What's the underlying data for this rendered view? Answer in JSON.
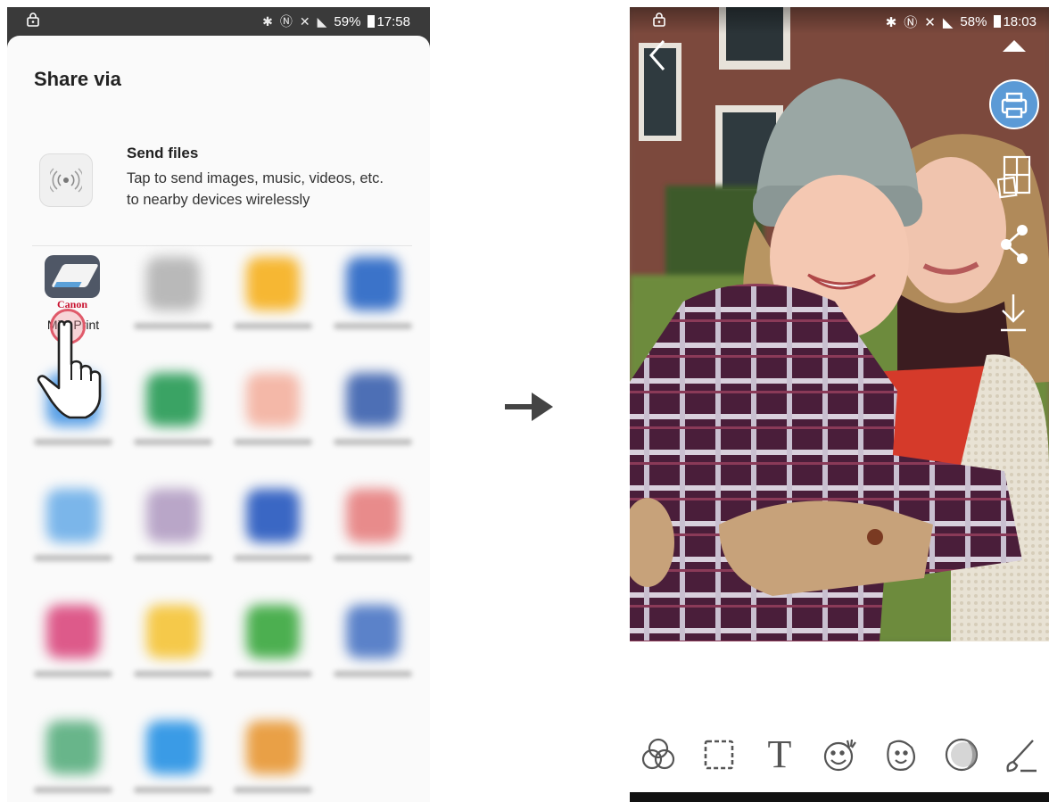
{
  "left_phone": {
    "status": {
      "icons": [
        "lock-icon",
        "bluetooth-icon",
        "nfc-icon",
        "mute-icon",
        "signal-icon"
      ],
      "battery": "59%",
      "time": "17:58"
    },
    "sheet_title": "Share via",
    "send_files": {
      "title": "Send files",
      "description": "Tap to send images, music, videos, etc. to nearby devices wirelessly"
    },
    "highlighted_app": {
      "brand": "Canon",
      "label": "Mini Print"
    },
    "blurred_app_icon_colors": [
      "#b9b9b9",
      "#f6b733",
      "#3b73c9",
      "#5aa0e6",
      "#3aa364",
      "#f4b8a8",
      "#4d6fb5",
      "#7bb6ea",
      "#b9a6c8",
      "#3a67c4",
      "#e88b8b",
      "#dd5a8a",
      "#f5c94a",
      "#4caf50",
      "#5b82c9",
      "#68b58a",
      "#3a9be6",
      "#e9a046"
    ]
  },
  "right_phone": {
    "status": {
      "icons": [
        "lock-icon",
        "bluetooth-icon",
        "nfc-icon",
        "mute-icon",
        "signal-icon"
      ],
      "battery": "58%",
      "time": "18:03"
    },
    "side_actions": [
      "back-arrow-icon",
      "collapse-icon",
      "print-icon",
      "layout-icon",
      "share-icon",
      "download-icon"
    ],
    "tools": [
      "filter-icon",
      "frame-icon",
      "text-icon",
      "sticker-icon",
      "face-icon",
      "adjust-icon",
      "brush-icon"
    ],
    "accent_color": "#5b9ad6"
  }
}
